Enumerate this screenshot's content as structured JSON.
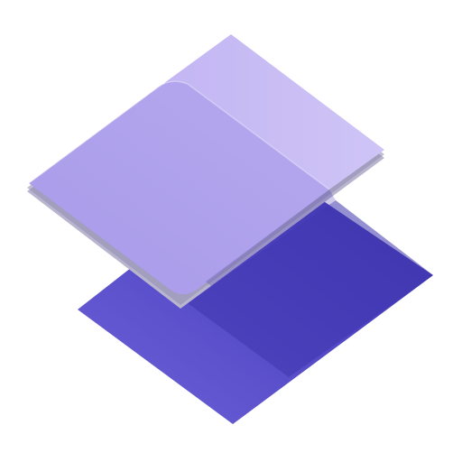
{
  "image": {
    "kind": "icon",
    "icon": "stacked-layers-icon",
    "layers": [
      {
        "role": "bottom",
        "colors": {
          "light": "#6f63d9",
          "dark": "#3e34ad",
          "shadow": "#2f2796"
        }
      },
      {
        "role": "top",
        "colors": {
          "light": "#a89ae8",
          "dark": "#cfc4f6",
          "glass": "#ffffff",
          "edge": "#8f8bb0",
          "shade": "#b9b5cf"
        }
      }
    ],
    "background": "#ffffff"
  }
}
